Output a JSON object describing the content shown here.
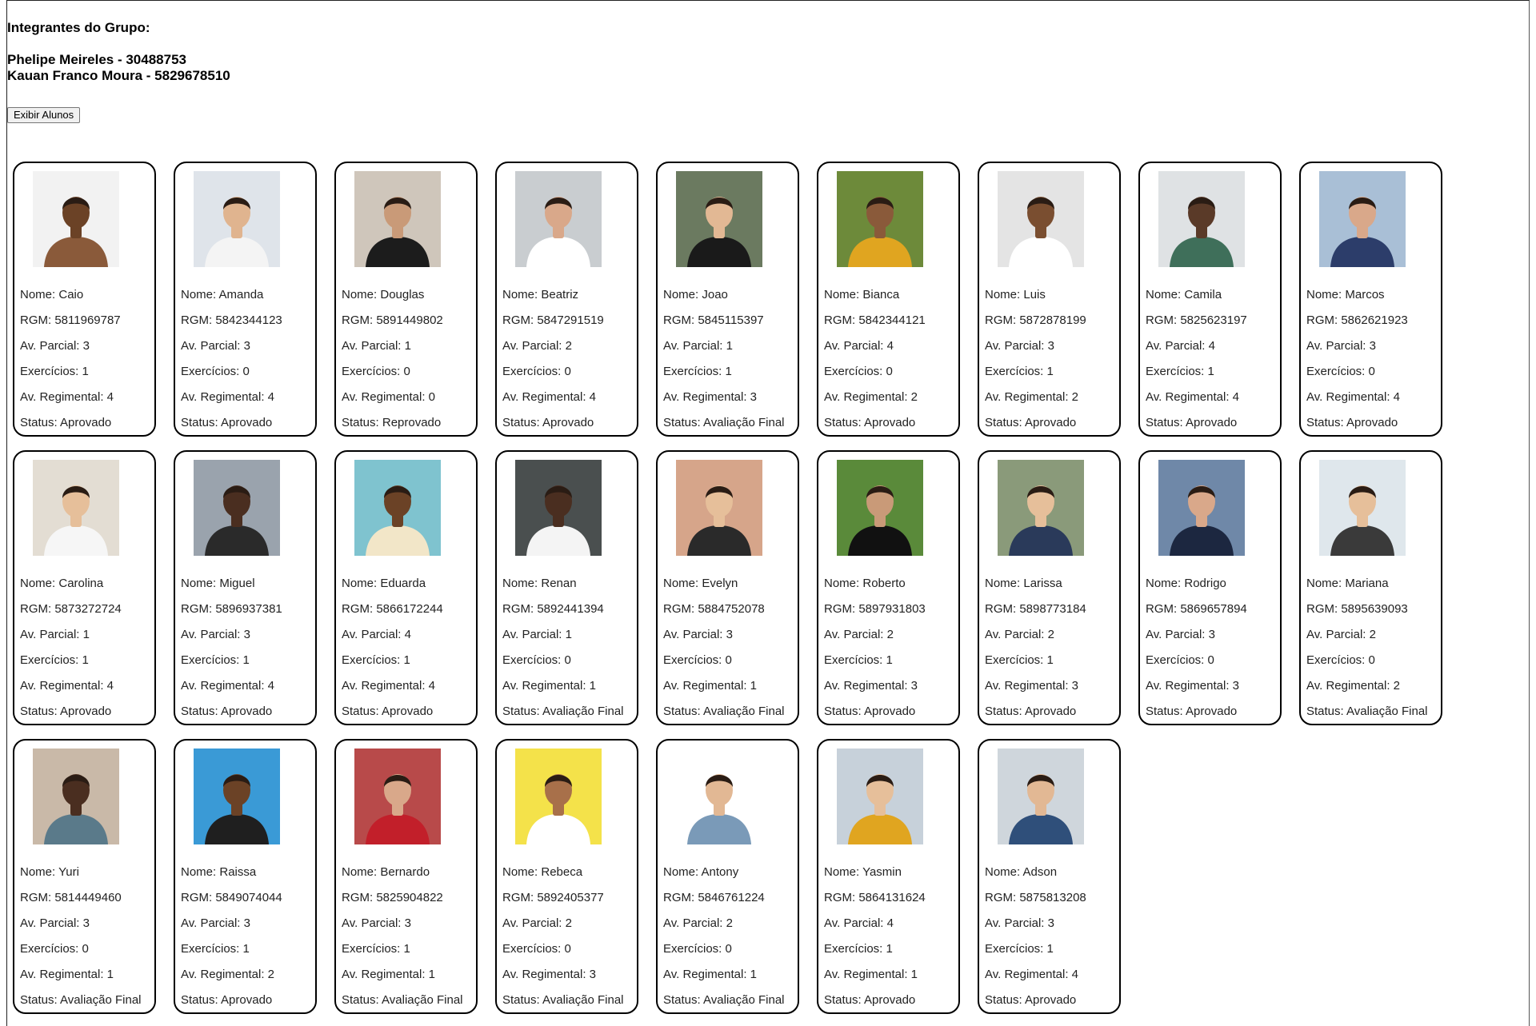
{
  "header": {
    "title": "Integrantes do Grupo:",
    "members": [
      "Phelipe Meireles - 30488753",
      "Kauan Franco Moura - 5829678510"
    ]
  },
  "button": {
    "label": "Exibir Alunos"
  },
  "labels": {
    "nome": "Nome: ",
    "rgm": "RGM: ",
    "parcial": "Av. Parcial: ",
    "exercicios": "Exercícios: ",
    "regimental": "Av. Regimental: ",
    "status": "Status: "
  },
  "students": [
    {
      "nome": "Caio",
      "rgm": "5811969787",
      "parcial": "3",
      "exercicios": "1",
      "regimental": "4",
      "status": "Aprovado",
      "bg": "#f2f2f2",
      "shirt": "#8a5a3a",
      "skin": "#6b4226"
    },
    {
      "nome": "Amanda",
      "rgm": "5842344123",
      "parcial": "3",
      "exercicios": "0",
      "regimental": "4",
      "status": "Aprovado",
      "bg": "#dfe4ea",
      "shirt": "#f4f4f4",
      "skin": "#e0b48f"
    },
    {
      "nome": "Douglas",
      "rgm": "5891449802",
      "parcial": "1",
      "exercicios": "0",
      "regimental": "0",
      "status": "Reprovado",
      "bg": "#cfc6bb",
      "shirt": "#1c1c1c",
      "skin": "#c99a78"
    },
    {
      "nome": "Beatriz",
      "rgm": "5847291519",
      "parcial": "2",
      "exercicios": "0",
      "regimental": "4",
      "status": "Aprovado",
      "bg": "#c9cdd0",
      "shirt": "#ffffff",
      "skin": "#d9a88a"
    },
    {
      "nome": "Joao",
      "rgm": "5845115397",
      "parcial": "1",
      "exercicios": "1",
      "regimental": "3",
      "status": "Avaliação Final",
      "bg": "#6b7a60",
      "shirt": "#1a1a1a",
      "skin": "#e2b894"
    },
    {
      "nome": "Bianca",
      "rgm": "5842344121",
      "parcial": "4",
      "exercicios": "0",
      "regimental": "2",
      "status": "Aprovado",
      "bg": "#6d8a3a",
      "shirt": "#e0a520",
      "skin": "#8a5a3a"
    },
    {
      "nome": "Luis",
      "rgm": "5872878199",
      "parcial": "3",
      "exercicios": "1",
      "regimental": "2",
      "status": "Aprovado",
      "bg": "#e4e4e4",
      "shirt": "#ffffff",
      "skin": "#7a4e30"
    },
    {
      "nome": "Camila",
      "rgm": "5825623197",
      "parcial": "4",
      "exercicios": "1",
      "regimental": "4",
      "status": "Aprovado",
      "bg": "#dfe2e4",
      "shirt": "#3f6f5a",
      "skin": "#5a3a28"
    },
    {
      "nome": "Marcos",
      "rgm": "5862621923",
      "parcial": "3",
      "exercicios": "0",
      "regimental": "4",
      "status": "Aprovado",
      "bg": "#a9bfd6",
      "shirt": "#2c3d6a",
      "skin": "#d9a88a"
    },
    {
      "nome": "Carolina",
      "rgm": "5873272724",
      "parcial": "1",
      "exercicios": "1",
      "regimental": "4",
      "status": "Aprovado",
      "bg": "#e3ddd3",
      "shirt": "#f6f6f6",
      "skin": "#e6bf9a"
    },
    {
      "nome": "Miguel",
      "rgm": "5896937381",
      "parcial": "3",
      "exercicios": "1",
      "regimental": "4",
      "status": "Aprovado",
      "bg": "#9aa3ad",
      "shirt": "#2a2a2a",
      "skin": "#4a2e20"
    },
    {
      "nome": "Eduarda",
      "rgm": "5866172244",
      "parcial": "4",
      "exercicios": "1",
      "regimental": "4",
      "status": "Aprovado",
      "bg": "#7fc3cf",
      "shirt": "#f2e6c8",
      "skin": "#6b4226"
    },
    {
      "nome": "Renan",
      "rgm": "5892441394",
      "parcial": "1",
      "exercicios": "0",
      "regimental": "1",
      "status": "Avaliação Final",
      "bg": "#4a4f4f",
      "shirt": "#f4f4f4",
      "skin": "#4a2e20"
    },
    {
      "nome": "Evelyn",
      "rgm": "5884752078",
      "parcial": "3",
      "exercicios": "0",
      "regimental": "1",
      "status": "Avaliação Final",
      "bg": "#d6a58a",
      "shirt": "#2a2a2a",
      "skin": "#e6bf9a"
    },
    {
      "nome": "Roberto",
      "rgm": "5897931803",
      "parcial": "2",
      "exercicios": "1",
      "regimental": "3",
      "status": "Aprovado",
      "bg": "#5a8a3a",
      "shirt": "#111111",
      "skin": "#c99a78"
    },
    {
      "nome": "Larissa",
      "rgm": "5898773184",
      "parcial": "2",
      "exercicios": "1",
      "regimental": "3",
      "status": "Aprovado",
      "bg": "#8a9a7a",
      "shirt": "#2a3a5a",
      "skin": "#e6bf9a"
    },
    {
      "nome": "Rodrigo",
      "rgm": "5869657894",
      "parcial": "3",
      "exercicios": "0",
      "regimental": "3",
      "status": "Aprovado",
      "bg": "#6f88a8",
      "shirt": "#1c2740",
      "skin": "#d9a88a"
    },
    {
      "nome": "Mariana",
      "rgm": "5895639093",
      "parcial": "2",
      "exercicios": "0",
      "regimental": "2",
      "status": "Avaliação Final",
      "bg": "#dfe7ec",
      "shirt": "#3a3a3a",
      "skin": "#e6bf9a"
    },
    {
      "nome": "Yuri",
      "rgm": "5814449460",
      "parcial": "3",
      "exercicios": "0",
      "regimental": "1",
      "status": "Avaliação Final",
      "bg": "#c9b9a8",
      "shirt": "#5a7a8a",
      "skin": "#4a2e20"
    },
    {
      "nome": "Raissa",
      "rgm": "5849074044",
      "parcial": "3",
      "exercicios": "1",
      "regimental": "2",
      "status": "Aprovado",
      "bg": "#3a9ad6",
      "shirt": "#1f1f1f",
      "skin": "#6b4226"
    },
    {
      "nome": "Bernardo",
      "rgm": "5825904822",
      "parcial": "3",
      "exercicios": "1",
      "regimental": "1",
      "status": "Avaliação Final",
      "bg": "#b84a4a",
      "shirt": "#c21f2a",
      "skin": "#d9a88a"
    },
    {
      "nome": "Rebeca",
      "rgm": "5892405377",
      "parcial": "2",
      "exercicios": "0",
      "regimental": "3",
      "status": "Avaliação Final",
      "bg": "#f4e24a",
      "shirt": "#ffffff",
      "skin": "#a8704a"
    },
    {
      "nome": "Antony",
      "rgm": "5846761224",
      "parcial": "2",
      "exercicios": "0",
      "regimental": "1",
      "status": "Avaliação Final",
      "bg": "#ffffff",
      "shirt": "#7a9ab8",
      "skin": "#e2b894"
    },
    {
      "nome": "Yasmin",
      "rgm": "5864131624",
      "parcial": "4",
      "exercicios": "1",
      "regimental": "1",
      "status": "Aprovado",
      "bg": "#c7d1da",
      "shirt": "#e0a520",
      "skin": "#e6bf9a"
    },
    {
      "nome": "Adson",
      "rgm": "5875813208",
      "parcial": "3",
      "exercicios": "1",
      "regimental": "4",
      "status": "Aprovado",
      "bg": "#cfd6dc",
      "shirt": "#2f4f7a",
      "skin": "#e2b894"
    }
  ]
}
